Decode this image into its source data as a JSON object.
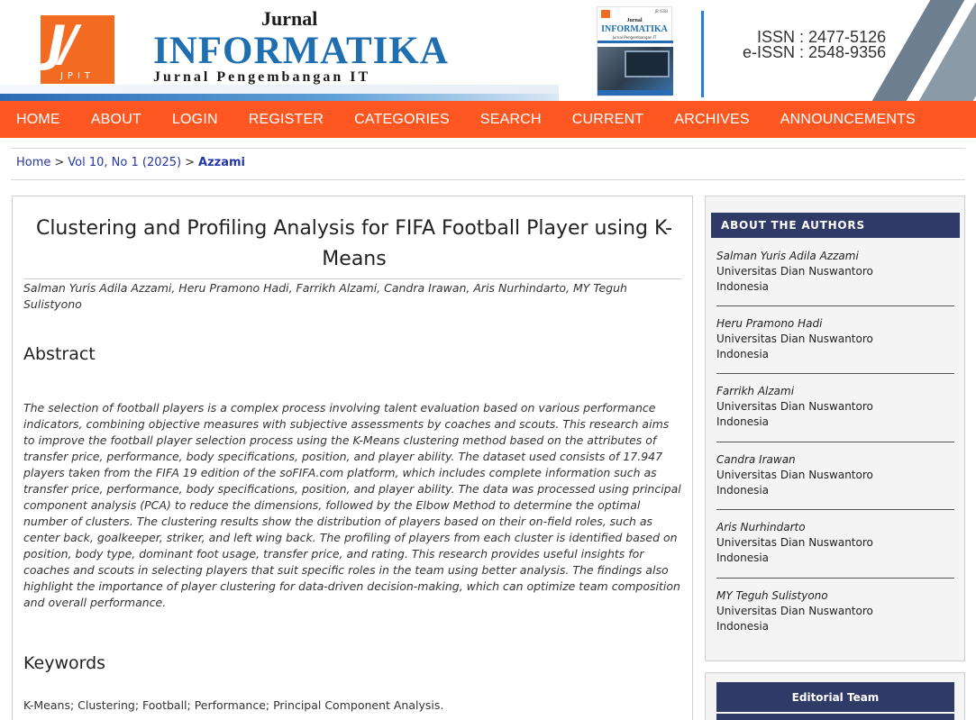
{
  "header": {
    "logo_glyph": "J/",
    "logo_small": "JPIT",
    "brand_top": "Jurnal",
    "brand_main": "INFORMATIKA",
    "brand_sub": "Jurnal Pengembangan IT",
    "cover": {
      "journal": "Jurnal",
      "title": "INFORMATIKA",
      "subtitle": "Jurnal Pengembangan IT",
      "issn_small": "JB ISSB"
    },
    "issn_label": "ISSN",
    "issn_value": ": 2477-5126",
    "eissn_label": "e-ISSN",
    "eissn_value": ": 2548-9356",
    "colors": {
      "orange": "#f26b21",
      "blue": "#1f6fb0"
    }
  },
  "nav": {
    "items": [
      "HOME",
      "ABOUT",
      "LOGIN",
      "REGISTER",
      "CATEGORIES",
      "SEARCH",
      "CURRENT",
      "ARCHIVES",
      "ANNOUNCEMENTS"
    ],
    "bg_color": "#ff5722"
  },
  "breadcrumb": {
    "home": "Home",
    "sep": ">",
    "issue": "Vol 10, No 1 (2025)",
    "current": "Azzami"
  },
  "article": {
    "title": "Clustering and Profiling Analysis for FIFA Football Player using K-Means",
    "authors": "Salman Yuris Adila Azzami, Heru Pramono Hadi, Farrikh Alzami, Candra Irawan, Aris Nurhindarto, MY Teguh Sulistyono",
    "abstract_heading": "Abstract",
    "abstract": "The selection of football players is a complex process involving talent evaluation based on various performance indicators, combining objective measures with subjective assessments by coaches and scouts. This research aims to improve the football player selection process using the K-Means clustering method based on the attributes of transfer price, performance, body specifications, position, and player ability. The dataset used consists of 17.947 players taken from the FIFA 19 edition of the soFIFA.com platform, which includes complete information such as transfer price, performance, body specifications, position, and player ability. The data was processed using principal component analysis (PCA) to reduce the dimensions, followed by the Elbow Method to determine the optimal number of clusters. The clustering results show the distribution of players based on their on-field roles, such as center back, goalkeeper, striker, and left wing back. The profiling of players from each cluster is identified based on position, body type, dominant foot usage, transfer price, and rating. This research provides useful insights for coaches and scouts in selecting players that suit specific roles in the team using better analysis. The findings also highlight the importance of player clustering for data-driven decision-making, which can optimize team composition and overall performance.",
    "keywords_heading": "Keywords",
    "keywords": "K-Means; Clustering; Football; Performance; Principal Component Analysis."
  },
  "sidebar": {
    "heading": "ABOUT THE AUTHORS",
    "authors": [
      {
        "name": "Salman Yuris Adila Azzami",
        "affiliation": "Universitas Dian Nuswantoro",
        "country": "Indonesia"
      },
      {
        "name": "Heru Pramono Hadi",
        "affiliation": "Universitas Dian Nuswantoro",
        "country": "Indonesia"
      },
      {
        "name": "Farrikh Alzami",
        "affiliation": "Universitas Dian Nuswantoro",
        "country": "Indonesia"
      },
      {
        "name": "Candra Irawan",
        "affiliation": "Universitas Dian Nuswantoro",
        "country": "Indonesia"
      },
      {
        "name": "Aris Nurhindarto",
        "affiliation": "Universitas Dian Nuswantoro",
        "country": "Indonesia"
      },
      {
        "name": "MY Teguh Sulistyono",
        "affiliation": "Universitas Dian Nuswantoro",
        "country": "Indonesia"
      }
    ],
    "editorial_heading": "Editorial Team",
    "head_color": "#2f3a66"
  }
}
